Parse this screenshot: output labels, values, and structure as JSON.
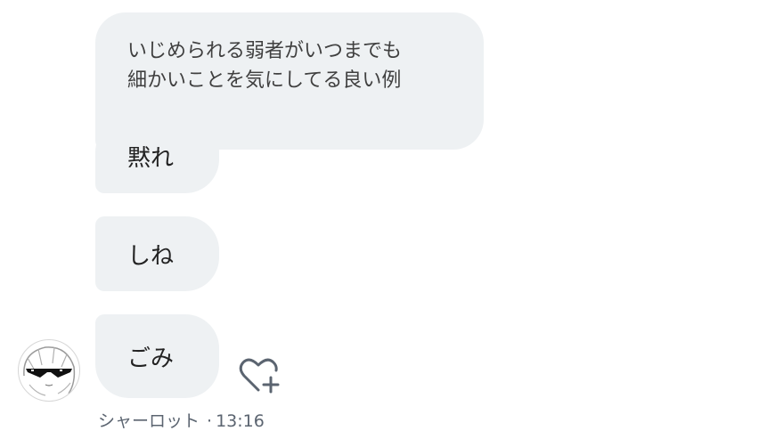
{
  "messages": {
    "quoted": {
      "line1": "いじめられる弱者がいつまでも",
      "line2": "細かいことを気にしてる良い例"
    },
    "m1": "黙れ",
    "m2": "しね",
    "m3": "ごみ"
  },
  "meta": {
    "sender": "シャーロット",
    "separator": "·",
    "time": "13:16"
  },
  "icons": {
    "avatar": "avatar-anime-sunglasses",
    "reaction": "heart-plus-icon"
  }
}
